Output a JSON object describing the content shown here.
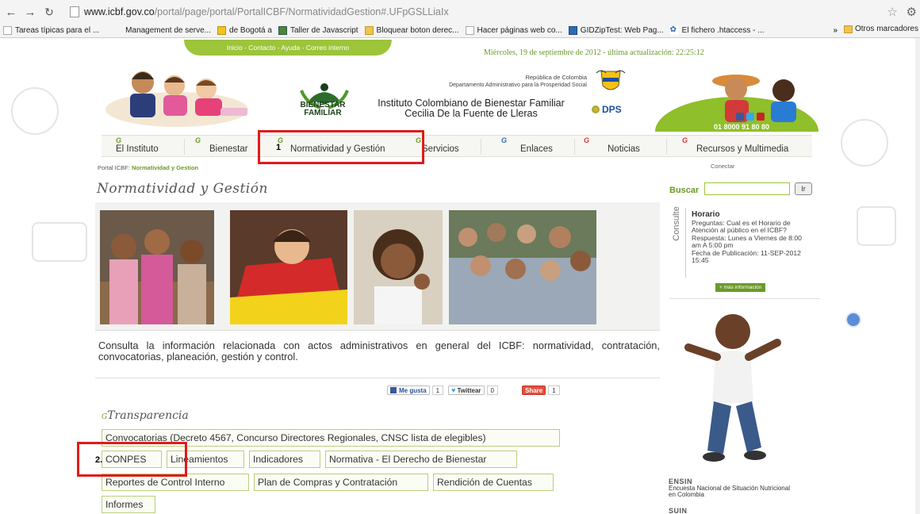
{
  "browser": {
    "url_host": "www.icbf.gov.co",
    "url_path": "/portal/page/portal/PortalICBF/NormatividadGestion#.UFpGSLLiaIx",
    "bookmarks": [
      {
        "label": "Tareas típicas para el ...",
        "icon": "page-icon"
      },
      {
        "label": "Management de serve...",
        "icon": "blank-icon"
      },
      {
        "label": "de Bogotá a",
        "icon": "people-icon"
      },
      {
        "label": "Taller de Javascript",
        "icon": "green-icon"
      },
      {
        "label": "Bloquear boton derec...",
        "icon": "folder-icon"
      },
      {
        "label": "Hacer páginas web co...",
        "icon": "page-icon"
      },
      {
        "label": "GIDZipTest: Web Pag...",
        "icon": "g-icon"
      },
      {
        "label": "El fichero .htaccess - ...",
        "icon": "swirl-icon"
      }
    ],
    "bookmarks_more": "»",
    "other_bookmarks": "Otros marcadores"
  },
  "topbar": {
    "links": "Inicio - Contacto - Ayuda - Correo interno",
    "date_line": "Miércoles, 19 de septiembre de 2012 - última actualización: 22:25:12"
  },
  "header": {
    "logo_text_1": "BIENESTAR",
    "logo_text_2": "FAMILIAR",
    "rep_line_1": "República de Colombia",
    "rep_line_2": "Departamento Administrativo para la Prosperidad Social",
    "institute_line_1": "Instituto Colombiano de Bienestar Familiar",
    "institute_line_2": "Cecilia De la Fuente de Lleras",
    "dps_label": "DPS",
    "phone": "01 8000 91 80 80"
  },
  "nav": {
    "items": [
      {
        "label": "El Instituto"
      },
      {
        "label": "Bienestar"
      },
      {
        "label": "Normatividad y Gestión"
      },
      {
        "label": "Servicios"
      },
      {
        "label": "Enlaces"
      },
      {
        "label": "Noticias"
      },
      {
        "label": "Recursos y Multimedia"
      }
    ]
  },
  "annotations": {
    "marker_1": "1",
    "marker_2": "2."
  },
  "breadcrumb": {
    "prefix": "Portal ICBF: ",
    "current": "Normatividad y Gestion"
  },
  "conectar": "Conectar",
  "page_title": "Normatividad y Gestión",
  "intro": "Consulta la información relacionada con actos administrativos en general del ICBF: normatividad, contratación, convocatorias, planeación, gestión y control.",
  "share": {
    "fb_label": "Me gusta",
    "fb_count": "1",
    "tw_label": "Twittear",
    "tw_count": "0",
    "share_label": "Share",
    "share_count": "1"
  },
  "transparencia": {
    "title": "Transparencia",
    "links": [
      {
        "label": "Convocatorias (Decreto 4567, Concurso Directores Regionales, CNSC lista de elegibles)"
      },
      {
        "label": "CONPES"
      },
      {
        "label": "Lineamientos"
      },
      {
        "label": "Indicadores"
      },
      {
        "label": "Normativa - El Derecho de Bienestar"
      },
      {
        "label": "Reportes de Control Interno"
      },
      {
        "label": "Plan de Compras y Contratación"
      },
      {
        "label": "Rendición de Cuentas"
      },
      {
        "label": "Informes"
      }
    ]
  },
  "sidebar": {
    "buscar": "Buscar",
    "search_value": "",
    "search_go": "Ir",
    "consulte": "Consulte",
    "faq_title": "Horario",
    "faq_lines": [
      "Preguntas: Cual es el Horario de",
      "Atención al público en el ICBF?",
      "Respuesta: Lunes a Viernes de 8:00",
      "am A 5:00 pm",
      "Fecha de Publicación: 11-SEP-2012",
      "15:45"
    ],
    "mas_info": "+ más información",
    "ensin_title": "ENSIN",
    "ensin_desc_1": "Encuesta Nacional de Situación Nutricional",
    "ensin_desc_2": "en Colombia",
    "suin_title": "SUIN"
  }
}
